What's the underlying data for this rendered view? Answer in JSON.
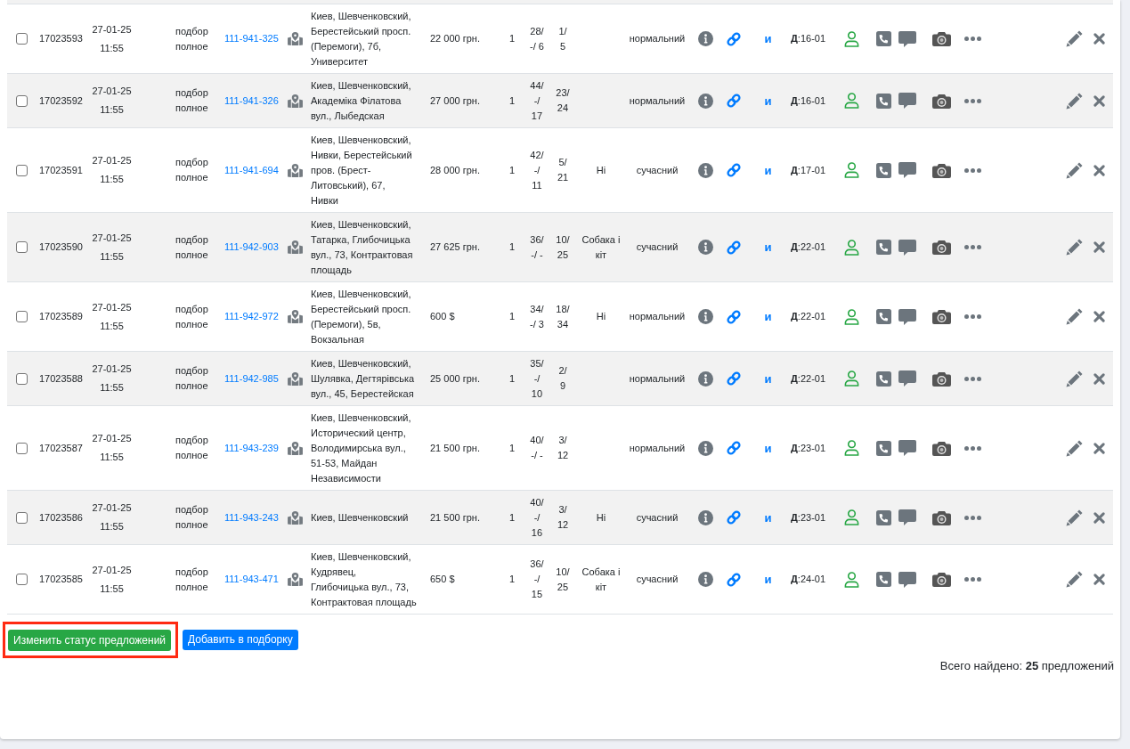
{
  "table": {
    "rows": [
      {
        "checked": false,
        "id": "17023593",
        "date": "27-01-25",
        "time": "11:55",
        "type": "подбор полное",
        "code": "111-941-325",
        "address": "Киев, Шевченковский,\nБерестейський просп.\n(Перемоги), 7б,\nУниверситет",
        "price": "22 000 грн.",
        "column_9": "1",
        "column_10": "28/\n-/ 6",
        "column_11": "1/\n5",
        "condition": "нормальний",
        "letter": "и",
        "label": "**Д**:16-01"
      },
      {
        "checked": false,
        "id": "17023592",
        "date": "27-01-25",
        "time": "11:55",
        "type": "подбор полное",
        "code": "111-941-326",
        "address": "Киев, Шевченковский,\nАкадеміка Філатова\nвул., Лыбедская",
        "price": "27 000 грн.",
        "column_9": "1",
        "column_10": "44/\n-/\n17",
        "column_11": "23/\n24",
        "condition": "нормальний",
        "letter": "и",
        "label": "**Д**:16-01"
      },
      {
        "checked": false,
        "id": "17023591",
        "date": "27-01-25",
        "time": "11:55",
        "type": "подбор полное",
        "code": "111-941-694",
        "address": "Киев, Шевченковский,\nНивки, Берестейський\nпров. (Брест-\nЛитовський), 67,\nНивки",
        "price": "28 000 грн.",
        "column_9": "1",
        "column_10": "42/\n-/\n11",
        "column_11": "5/\n21",
        "pets": "Ні",
        "condition": "сучасний",
        "letter": "и",
        "label": "**Д**:17-01"
      },
      {
        "checked": false,
        "id": "17023590",
        "date": "27-01-25",
        "time": "11:55",
        "type": "подбор полное",
        "code": "111-942-903",
        "address": "Киев, Шевченковский,\nТатарка, Глибочицька\nвул., 73, Контрактовая\nплощадь",
        "price": "27 625 грн.",
        "column_9": "1",
        "column_10": "36/\n-/ -",
        "column_11": "10/\n25",
        "pets": "Собака і\nкіт",
        "condition": "сучасний",
        "letter": "и",
        "label": "**Д**:22-01"
      },
      {
        "checked": false,
        "id": "17023589",
        "date": "27-01-25",
        "time": "11:55",
        "type": "подбор полное",
        "code": "111-942-972",
        "address": "Киев, Шевченковский,\nБерестейський просп.\n(Перемоги), 5в,\nВокзальная",
        "price": "600 $",
        "column_9": "1",
        "column_10": "34/\n-/ 3",
        "column_11": "18/\n34",
        "pets": "Ні",
        "condition": "нормальний",
        "letter": "и",
        "label": "**Д**:22-01"
      },
      {
        "checked": false,
        "id": "17023588",
        "date": "27-01-25",
        "time": "11:55",
        "type": "подбор полное",
        "code": "111-942-985",
        "address": "Киев, Шевченковский,\nШулявка, Дегтярівська\nвул., 45, Берестейская",
        "price": "25 000 грн.",
        "column_9": "1",
        "column_10": "35/\n-/\n10",
        "column_11": "2/\n9",
        "condition": "нормальний",
        "letter": "и",
        "label": "**Д**:22-01"
      },
      {
        "checked": false,
        "id": "17023587",
        "date": "27-01-25",
        "time": "11:55",
        "type": "подбор полное",
        "code": "111-943-239",
        "address": "Киев, Шевченковский,\nИсторический центр,\nВолодимирська вул.,\n51-53, Майдан\nНезависимости",
        "price": "21 500 грн.",
        "column_9": "1",
        "column_10": "40/\n-/ -",
        "column_11": "3/\n12",
        "condition": "нормальний",
        "letter": "и",
        "label": "**Д**:23-01"
      },
      {
        "checked": false,
        "id": "17023586",
        "date": "27-01-25",
        "time": "11:55",
        "type": "подбор полное",
        "code": "111-943-243",
        "address": "Киев, Шевченковский",
        "price": "21 500 грн.",
        "column_9": "1",
        "column_10": "40/\n-/\n16",
        "column_11": "3/\n12",
        "pets": "Ні",
        "condition": "сучасний",
        "letter": "и",
        "label": "**Д**:23-01"
      },
      {
        "checked": false,
        "id": "17023585",
        "date": "27-01-25",
        "time": "11:55",
        "type": "подбор полное",
        "code": "111-943-471",
        "address": "Киев, Шевченковский,\nКудрявец,\nГлибочицька вул., 73,\nКонтрактовая площадь",
        "price": "650 $",
        "column_9": "1",
        "column_10": "36/\n-/\n15",
        "column_11": "10/\n25",
        "pets": "Собака і\nкіт",
        "condition": "сучасний",
        "letter": "и",
        "label": "**Д**:24-01"
      }
    ]
  },
  "actions": [
    {
      "label": "Изменить статус предложений",
      "kind": "success",
      "highlighted": true
    },
    {
      "label": "Добавить в подборку",
      "kind": "primary",
      "highlighted": false
    }
  ],
  "total": "Всего найдено: **25** предложений"
}
